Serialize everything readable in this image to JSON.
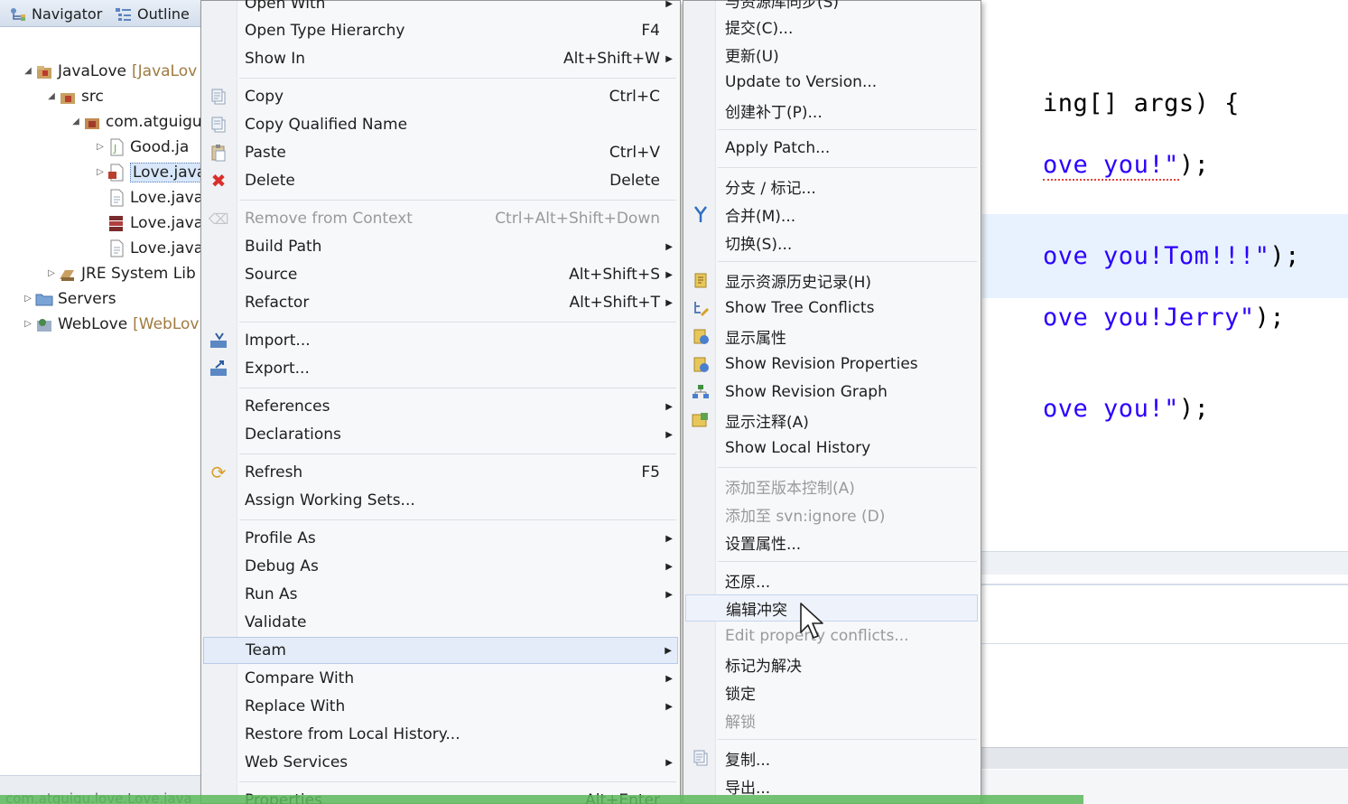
{
  "explorer": {
    "tabs": [
      {
        "label": "Navigator",
        "icon": "navigator-icon"
      },
      {
        "label": "Outline",
        "icon": "outline-icon"
      }
    ],
    "tree": [
      {
        "label": "JavaLove",
        "suffix": "[JavaLov",
        "icon": "java-project-icon"
      },
      {
        "label": "src",
        "icon": "source-folder-icon"
      },
      {
        "label": "com.atguigu",
        "icon": "package-icon"
      },
      {
        "label": "Good.ja",
        "icon": "java-file-icon"
      },
      {
        "label": "Love.java",
        "icon": "java-file-icon"
      },
      {
        "label": "Love.java",
        "icon": "file-icon"
      },
      {
        "label": "Love.java",
        "icon": "jar-icon"
      },
      {
        "label": "Love.java",
        "icon": "file-icon"
      },
      {
        "label": "JRE System Lib",
        "icon": "library-icon"
      },
      {
        "label": "Servers",
        "icon": "folder-icon"
      },
      {
        "label": "WebLove",
        "suffix": "[WebLov",
        "icon": "web-project-icon"
      }
    ],
    "status": "com.atguigu.love.Love.java"
  },
  "editor": {
    "lines": [
      {
        "code": "ing[] args) {",
        "str": ""
      },
      {
        "code": "",
        "str": "ove you!\"",
        "tail": ");"
      },
      {
        "code": "",
        "str": "ove you!Tom!!!\"",
        "tail": ");"
      },
      {
        "code": "",
        "str": "ove you!Jerry\"",
        "tail": ");"
      },
      {
        "code": "",
        "str": "ove you!\"",
        "tail": ");"
      }
    ]
  },
  "context_menu": {
    "items": [
      {
        "label": "Open With",
        "shortcut": "",
        "submenu": true
      },
      {
        "label": "Open Type Hierarchy",
        "shortcut": "F4"
      },
      {
        "label": "Show In",
        "shortcut": "Alt+Shift+W",
        "submenu": true
      },
      {
        "label": "Copy",
        "shortcut": "Ctrl+C",
        "icon": "copy-icon"
      },
      {
        "label": "Copy Qualified Name",
        "shortcut": "",
        "icon": "copy-qualified-icon"
      },
      {
        "label": "Paste",
        "shortcut": "Ctrl+V",
        "icon": "paste-icon"
      },
      {
        "label": "Delete",
        "shortcut": "Delete",
        "icon": "delete-icon"
      },
      {
        "label": "Remove from Context",
        "shortcut": "Ctrl+Alt+Shift+Down",
        "icon": "remove-context-icon",
        "disabled": true
      },
      {
        "label": "Build Path",
        "submenu": true
      },
      {
        "label": "Source",
        "shortcut": "Alt+Shift+S",
        "submenu": true
      },
      {
        "label": "Refactor",
        "shortcut": "Alt+Shift+T",
        "submenu": true
      },
      {
        "label": "Import...",
        "icon": "import-icon"
      },
      {
        "label": "Export...",
        "icon": "export-icon"
      },
      {
        "label": "References",
        "submenu": true
      },
      {
        "label": "Declarations",
        "submenu": true
      },
      {
        "label": "Refresh",
        "shortcut": "F5",
        "icon": "refresh-icon"
      },
      {
        "label": "Assign Working Sets..."
      },
      {
        "label": "Profile As",
        "submenu": true
      },
      {
        "label": "Debug As",
        "submenu": true
      },
      {
        "label": "Run As",
        "submenu": true
      },
      {
        "label": "Validate"
      },
      {
        "label": "Team",
        "submenu": true,
        "active": true
      },
      {
        "label": "Compare With",
        "submenu": true
      },
      {
        "label": "Replace With",
        "submenu": true
      },
      {
        "label": "Restore from Local History..."
      },
      {
        "label": "Web Services",
        "submenu": true
      },
      {
        "label": "Properties",
        "shortcut": "Alt+Enter"
      }
    ]
  },
  "team_menu": {
    "items": [
      {
        "label": "与资源库同步(S)"
      },
      {
        "label": "提交(C)..."
      },
      {
        "label": "更新(U)"
      },
      {
        "label": "Update to Version..."
      },
      {
        "label": "创建补丁(P)..."
      },
      {
        "label": "Apply Patch..."
      },
      {
        "label": "分支 / 标记..."
      },
      {
        "label": "合并(M)...",
        "icon": "merge-icon"
      },
      {
        "label": "切换(S)..."
      },
      {
        "label": "显示资源历史记录(H)",
        "icon": "history-icon"
      },
      {
        "label": "Show Tree Conflicts",
        "icon": "tree-conflicts-icon"
      },
      {
        "label": "显示属性",
        "icon": "properties-icon"
      },
      {
        "label": "Show Revision Properties",
        "icon": "revision-properties-icon"
      },
      {
        "label": "Show Revision Graph",
        "icon": "revision-graph-icon"
      },
      {
        "label": "显示注释(A)",
        "icon": "annotate-icon"
      },
      {
        "label": "Show Local History"
      },
      {
        "label": "添加至版本控制(A)",
        "disabled": true
      },
      {
        "label": "添加至 svn:ignore (D)",
        "disabled": true
      },
      {
        "label": "设置属性..."
      },
      {
        "label": "还原..."
      },
      {
        "label": "编辑冲突",
        "hover": true
      },
      {
        "label": "Edit property conflicts...",
        "disabled": true
      },
      {
        "label": "标记为解决"
      },
      {
        "label": "锁定"
      },
      {
        "label": "解锁",
        "disabled": true
      },
      {
        "label": "复制...",
        "icon": "copy-icon"
      },
      {
        "label": "导出..."
      }
    ]
  }
}
